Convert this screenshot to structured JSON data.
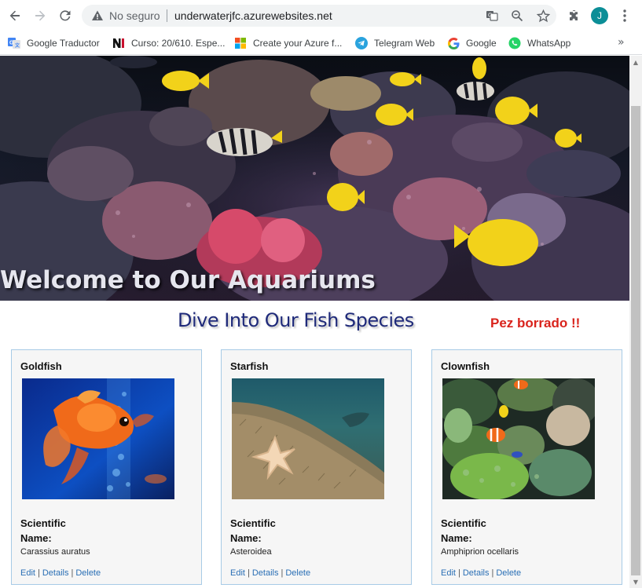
{
  "browser": {
    "security_label": "No seguro",
    "url": "underwaterjfc.azurewebsites.net",
    "profile_initial": "J"
  },
  "bookmarks": [
    {
      "label": "Google Traductor",
      "icon": "google-translate-icon"
    },
    {
      "label": "Curso: 20/610. Espe...",
      "icon": "ni-icon"
    },
    {
      "label": "Create your Azure f...",
      "icon": "microsoft-icon"
    },
    {
      "label": "Telegram Web",
      "icon": "telegram-icon"
    },
    {
      "label": "Google",
      "icon": "google-icon"
    },
    {
      "label": "WhatsApp",
      "icon": "whatsapp-icon"
    }
  ],
  "bookmarks_more": "»",
  "page": {
    "hero_title": "Welcome to Our Aquariums",
    "subtitle": "Dive Into Our Fish Species",
    "alert": "Pez borrado !!",
    "scientific_label": "Scientific Name:",
    "cards": [
      {
        "name": "Goldfish",
        "scientific": "Carassius auratus",
        "edit": "Edit",
        "details": "Details",
        "delete": "Delete"
      },
      {
        "name": "Starfish",
        "scientific": "Asteroidea",
        "edit": "Edit",
        "details": "Details",
        "delete": "Delete"
      },
      {
        "name": "Clownfish",
        "scientific": "Amphiprion ocellaris",
        "edit": "Edit",
        "details": "Details",
        "delete": "Delete"
      }
    ]
  },
  "colors": {
    "subtitle": "#1f2a7a",
    "alert": "#d9231c",
    "link": "#2a6fb5",
    "card_border": "#a7cbe6"
  }
}
